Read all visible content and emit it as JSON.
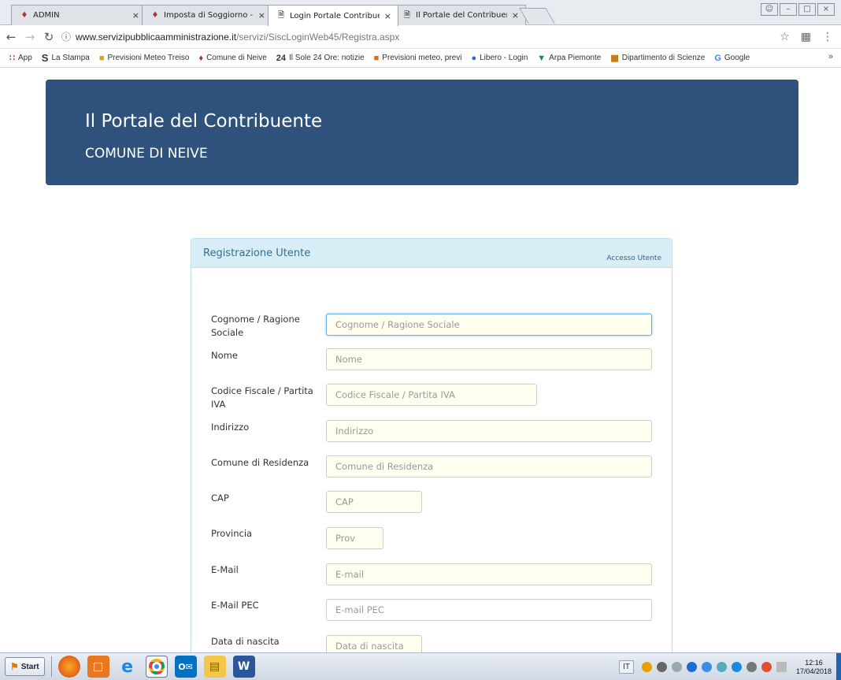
{
  "browser": {
    "tabs": [
      {
        "label": "ADMIN",
        "icon": "app-icon",
        "active": false
      },
      {
        "label": "Imposta di Soggiorno - Ser",
        "icon": "app-icon",
        "active": false
      },
      {
        "label": "Login Portale Contribuente",
        "icon": "page-icon",
        "active": true
      },
      {
        "label": "Il Portale del Contribuente",
        "icon": "page-icon",
        "active": false
      }
    ],
    "url_host": "www.servizipubblicaamministrazione.it",
    "url_path": "/servizi/SiscLoginWeb45/Registra.aspx",
    "bookmarks": [
      {
        "label": "App",
        "icon": "apps-grid-icon"
      },
      {
        "label": "La Stampa",
        "icon": "S"
      },
      {
        "label": "Previsioni Meteo Treiso",
        "icon": "weather-icon"
      },
      {
        "label": "Comune di Neive",
        "icon": "crest-icon"
      },
      {
        "label": "Il Sole 24 Ore: notizie",
        "icon": "24"
      },
      {
        "label": "Previsioni meteo, previ",
        "icon": "weather-icon"
      },
      {
        "label": "Libero - Login",
        "icon": "libero-icon"
      },
      {
        "label": "Arpa Piemonte",
        "icon": "arpa-icon"
      },
      {
        "label": "Dipartimento di Scienze",
        "icon": "dept-icon"
      },
      {
        "label": "Google",
        "icon": "G"
      }
    ]
  },
  "banner": {
    "title": "Il Portale del Contribuente",
    "subtitle": "COMUNE DI NEIVE"
  },
  "panel": {
    "title": "Registrazione Utente",
    "link": "Accesso Utente"
  },
  "form": {
    "cognome": {
      "label": "Cognome / Ragione Sociale",
      "placeholder": "Cognome / Ragione Sociale"
    },
    "nome": {
      "label": "Nome",
      "placeholder": "Nome"
    },
    "codice_fiscale": {
      "label": "Codice Fiscale / Partita IVA",
      "placeholder": "Codice Fiscale / Partita IVA"
    },
    "indirizzo": {
      "label": "Indirizzo",
      "placeholder": "Indirizzo"
    },
    "comune": {
      "label": "Comune di Residenza",
      "placeholder": "Comune di Residenza"
    },
    "cap": {
      "label": "CAP",
      "placeholder": "CAP"
    },
    "provincia": {
      "label": "Provincia",
      "placeholder": "Prov"
    },
    "email": {
      "label": "E-Mail",
      "placeholder": "E-mail"
    },
    "pec": {
      "label": "E-Mail PEC",
      "placeholder": "E-mail PEC"
    },
    "nascita": {
      "label": "Data di nascita",
      "placeholder": "Data di nascita"
    }
  },
  "taskbar": {
    "start_label": "Start",
    "language": "IT",
    "time": "12:16",
    "date": "17/04/2018"
  },
  "colors": {
    "banner_bg": "#2f527c",
    "panel_header_bg": "#d9edf7",
    "input_bg": "#fffff0"
  }
}
